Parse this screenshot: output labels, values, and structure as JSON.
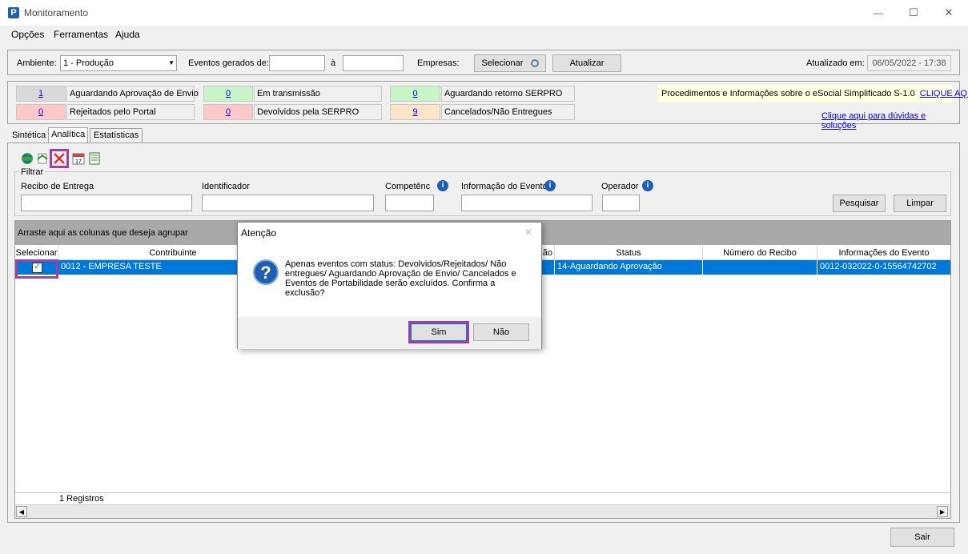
{
  "window": {
    "title": "Monitoramento",
    "app_icon": "P",
    "minimize": "—",
    "maximize": "☐",
    "close": "✕"
  },
  "menu": [
    "Opções",
    "Ferramentas",
    "Ajuda"
  ],
  "filters": {
    "ambiente_label": "Ambiente:",
    "ambiente_value": "1 - Produção",
    "eventos_label": "Eventos gerados de:",
    "date_from": "",
    "a_label": "à",
    "date_to": "",
    "empresas_label": "Empresas:",
    "selecionar": "Selecionar",
    "atualizar": "Atualizar",
    "atualizado_label": "Atualizado em:",
    "atualizado_value": "06/05/2022 - 17:38"
  },
  "status": {
    "aguardando_envio": {
      "count": "1",
      "label": "Aguardando Aprovação de Envio",
      "color": "#d9d9d9"
    },
    "em_transmissao": {
      "count": "0",
      "label": "Em transmissão",
      "color": "#c8f5c8"
    },
    "aguardando_serpro": {
      "count": "0",
      "label": "Aguardando retorno SERPRO",
      "color": "#c8f5c8"
    },
    "rejeitados": {
      "count": "0",
      "label": "Rejeitados pelo Portal",
      "color": "#ffc8c8"
    },
    "devolvidos": {
      "count": "0",
      "label": "Devolvidos pela SERPRO",
      "color": "#ffc8c8"
    },
    "cancelados": {
      "count": "9",
      "label": "Cancelados/Não Entregues",
      "color": "#fce4c8"
    }
  },
  "info": {
    "procedimentos": "Procedimentos e Informações sobre o eSocial Simplificado S-1.0",
    "clique_aqui": "CLIQUE AQUI",
    "duvidas": "Clique aqui para dúvidas e soluções"
  },
  "tabs": [
    "Sintética",
    "Analítica",
    "Estatísticas"
  ],
  "filtrar": {
    "title": "Filtrar",
    "recibo": "Recibo de Entrega",
    "identificador": "Identificador",
    "competencia": "Competênc",
    "informacao": "Informação do Evento",
    "operador": "Operador",
    "pesquisar": "Pesquisar",
    "limpar": "Limpar"
  },
  "grid": {
    "group_hint": "Arraste aqui as colunas que deseja agrupar",
    "headers": {
      "selecionar": "Selecionar",
      "contribuinte": "Contribuinte",
      "hidden_partial": "ão",
      "status": "Status",
      "numero_recibo": "Número do Recibo",
      "informacoes": "Informações do Evento"
    },
    "rows": [
      {
        "contribuinte": "0012 - EMPRESA TESTE",
        "status": "14-Aguardando Aprovação",
        "numero_recibo": "",
        "informacoes": "0012-032022-0-15564742702",
        "selected": true
      }
    ],
    "footer": "1 Registros",
    "row_color": "#0078d7"
  },
  "dialog": {
    "title": "Atenção",
    "message": "Apenas eventos com status: Devolvidos/Rejeitados/ Não entregues/ Aguardando Aprovação de Envio/ Cancelados e Eventos de Portabilidade serão excluídos. Confirma a exclusão?",
    "sim": "Sim",
    "nao": "Não",
    "icon": "question-icon"
  },
  "sair": "Sair",
  "highlight_color": "#a040a0"
}
